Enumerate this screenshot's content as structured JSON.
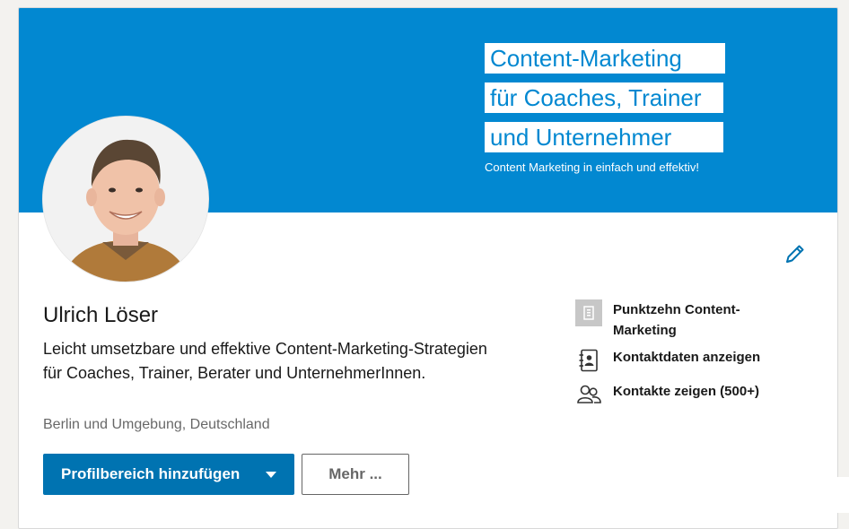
{
  "banner": {
    "line1": "Content-Marketing",
    "line2": "für Coaches, Trainer",
    "line3": "und Unternehmer",
    "tagline": "Content Marketing in einfach und effektiv!"
  },
  "profile": {
    "name": "Ulrich Löser",
    "headline": "Leicht umsetzbare und effektive Content-Marketing-Strategien für Coaches, Trainer, Berater und UnternehmerInnen.",
    "location": "Berlin und Umgebung, Deutschland"
  },
  "actions": {
    "primary_label": "Profilbereich hinzufügen",
    "secondary_label": "Mehr ..."
  },
  "sidebar": {
    "company": "Punktzehn Content-Marketing",
    "contact_info": "Kontaktdaten anzeigen",
    "connections": "Kontakte zeigen (500+)"
  },
  "colors": {
    "banner_blue": "#0288d1",
    "primary_button": "#0073b1",
    "edit_icon": "#0073b1"
  },
  "icons": {
    "edit": "pencil-icon",
    "company": "company-logo-icon",
    "contact": "address-book-icon",
    "connections": "people-icon",
    "dropdown": "caret-down-icon"
  }
}
